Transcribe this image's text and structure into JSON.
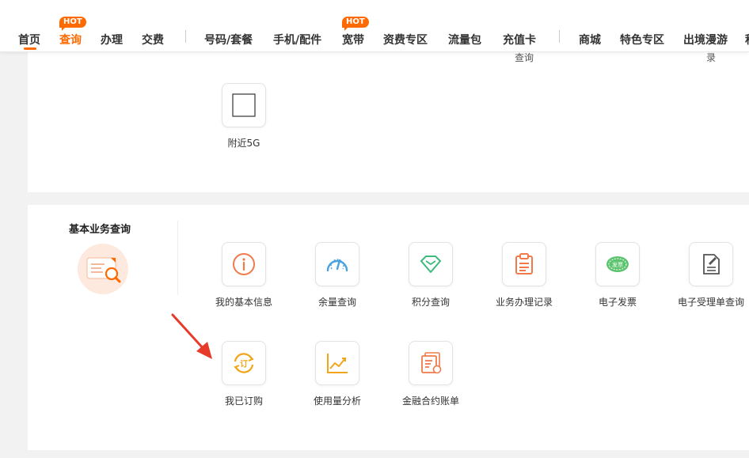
{
  "nav": {
    "items": [
      {
        "label": "首页"
      },
      {
        "label": "查询"
      },
      {
        "label": "办理"
      },
      {
        "label": "交费"
      },
      {
        "label": "号码/套餐"
      },
      {
        "label": "手机/配件"
      },
      {
        "label": "宽带"
      },
      {
        "label": "资费专区"
      },
      {
        "label": "流量包"
      },
      {
        "label": "充值卡"
      },
      {
        "label": "商城"
      },
      {
        "label": "特色专区"
      },
      {
        "label": "出境漫游"
      },
      {
        "label": "积"
      }
    ],
    "hot_badge": "HOT",
    "active_color": "#ff6a00"
  },
  "top_section": {
    "overflow_labels": [
      "查询",
      "录"
    ],
    "items": [
      {
        "label": "附近5G",
        "icon": "square-outline-icon"
      }
    ]
  },
  "basic_query": {
    "title": "基本业务查询",
    "badge_icon": "document-search-icon",
    "items": [
      {
        "label": "我的基本信息",
        "icon": "info-icon"
      },
      {
        "label": "余量查询",
        "icon": "gauge-icon"
      },
      {
        "label": "积分查询",
        "icon": "diamond-icon"
      },
      {
        "label": "业务办理记录",
        "icon": "clipboard-icon"
      },
      {
        "label": "电子发票",
        "icon": "invoice-icon",
        "icon_text": "发票"
      },
      {
        "label": "电子受理单查询",
        "icon": "document-edit-icon"
      },
      {
        "label": "我已订购",
        "icon": "subscription-icon",
        "icon_text": "订"
      },
      {
        "label": "使用量分析",
        "icon": "chart-icon"
      },
      {
        "label": "金融合约账单",
        "icon": "bill-icon"
      }
    ]
  }
}
